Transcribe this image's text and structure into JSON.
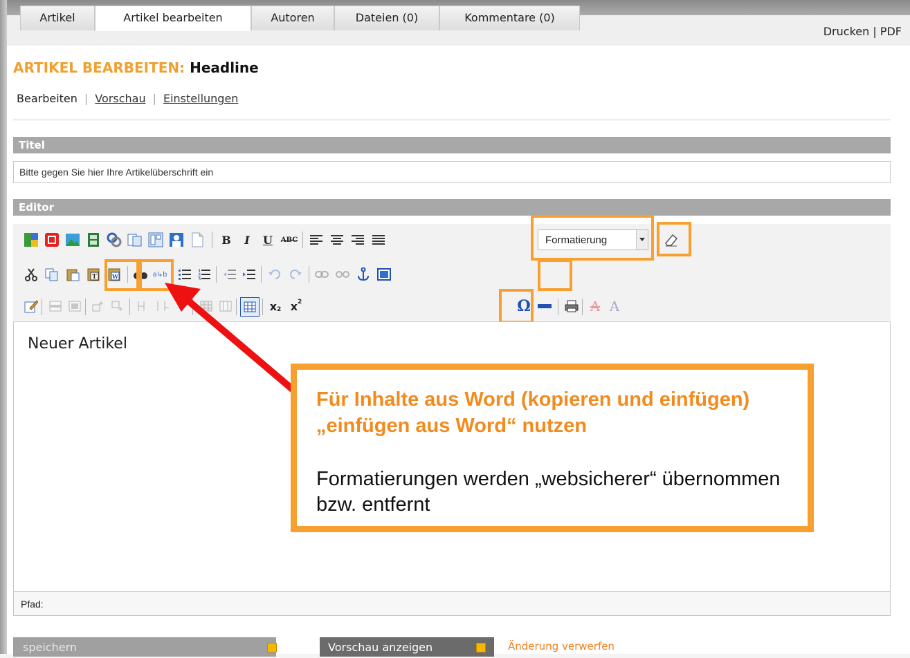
{
  "tabs": [
    {
      "label": "Artikel",
      "active": false
    },
    {
      "label": "Artikel bearbeiten",
      "active": true
    },
    {
      "label": "Autoren",
      "active": false
    },
    {
      "label": "Dateien (0)",
      "active": false
    },
    {
      "label": "Kommentare (0)",
      "active": false
    }
  ],
  "print_links": {
    "print": "Drucken",
    "separator": "|",
    "pdf": "PDF"
  },
  "page_title": {
    "prefix": "ARTIKEL BEARBEITEN:",
    "name": "Headline"
  },
  "subnav": {
    "active": "Bearbeiten",
    "preview": "Vorschau",
    "settings": "Einstellungen",
    "separator": "|"
  },
  "title_section": {
    "header": "Titel",
    "value": "Bitte gegen Sie hier Ihre Artikelüberschrift ein"
  },
  "editor_section": {
    "header": "Editor",
    "format_dropdown": "Formatierung",
    "content": "Neuer Artikel",
    "path_label": "Pfad:"
  },
  "toolbar_icons": {
    "row1": [
      "media-icon",
      "flash-icon",
      "image-icon",
      "video-icon",
      "link-manager-icon",
      "copy-template-icon",
      "layout-icon",
      "user-icon",
      "document-icon",
      "bold-icon",
      "italic-icon",
      "underline-icon",
      "strikethrough-icon",
      "align-left-icon",
      "align-center-icon",
      "align-right-icon",
      "justify-icon",
      "clean-format-icon"
    ],
    "row2": [
      "cut-icon",
      "copy-icon",
      "paste-icon",
      "paste-text-icon",
      "paste-word-icon",
      "find-icon",
      "replace-icon",
      "bullet-list-icon",
      "numbered-list-icon",
      "outdent-icon",
      "indent-icon",
      "undo-icon",
      "redo-icon",
      "link-icon",
      "unlink-icon",
      "anchor-icon",
      "fullscreen-icon"
    ],
    "row3": [
      "edit-icon",
      "table-row-icon",
      "table-delete-icon",
      "insert-row-before-icon",
      "insert-row-after-icon",
      "merge-cells-icon",
      "split-cells-icon",
      "insert-column-icon",
      "table-props-icon",
      "cell-props-icon",
      "insert-table-icon",
      "subscript-icon",
      "superscript-icon",
      "special-char-icon",
      "horizontal-rule-icon",
      "print-icon",
      "font-color-icon",
      "background-color-icon"
    ]
  },
  "callout": {
    "title": "Für Inhalte aus Word (kopieren und einfügen) „einfügen aus Word“ nutzen",
    "body": "Formatierungen werden „websicherer“ übernommen bzw. entfernt"
  },
  "actions": {
    "save": "speichern",
    "preview": "Vorschau anzeigen",
    "discard": "Änderung verwerfen"
  },
  "colors": {
    "accent": "#f7a030",
    "arrow": "#ee1111",
    "section_bar": "#a8a8a8"
  }
}
